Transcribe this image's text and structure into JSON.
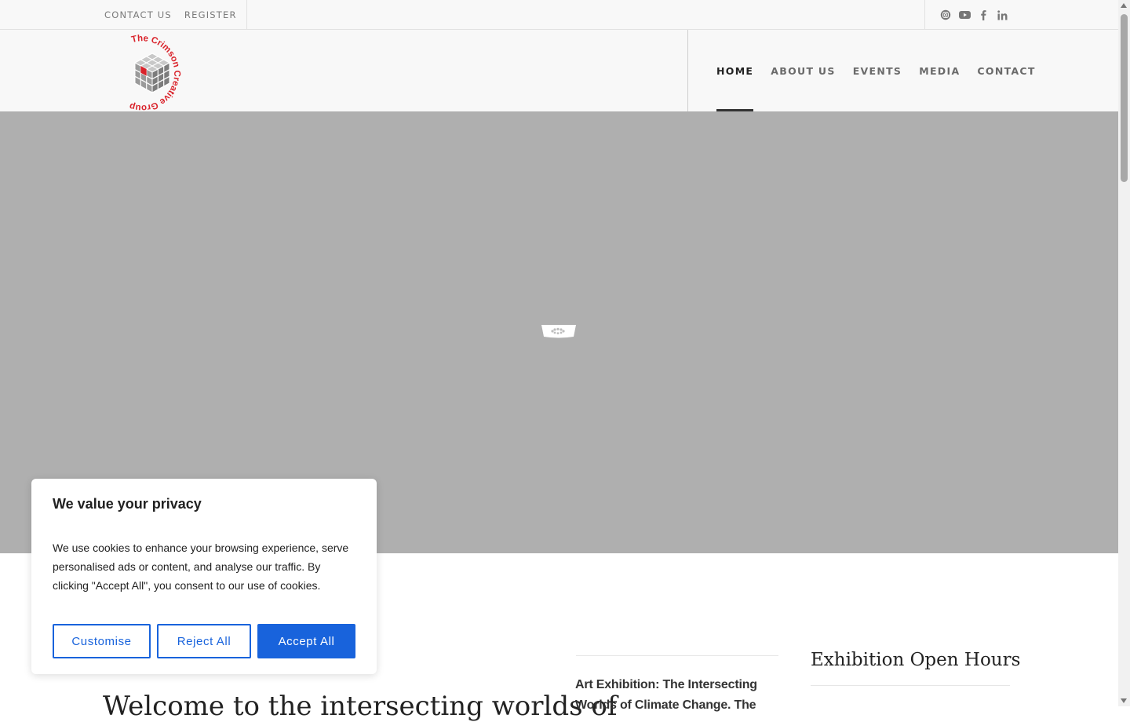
{
  "topbar": {
    "links": [
      "CONTACT US",
      "REGISTER"
    ],
    "social_icons": [
      "instagram-icon",
      "youtube-icon",
      "facebook-icon",
      "linkedin-icon"
    ]
  },
  "brand": {
    "logo_text": "The Crimson Creative Group",
    "accent_color": "#d9222a"
  },
  "nav": {
    "items": [
      "HOME",
      "ABOUT US",
      "EVENTS",
      "MEDIA",
      "CONTACT"
    ],
    "active": "HOME"
  },
  "hero": {
    "background": "#afafaf",
    "loader_icon": "loading-spinner-icon"
  },
  "content": {
    "welcome_heading": "Welcome to the intersecting worlds of",
    "post_title": "Art Exhibition: The Intersecting Worlds of Climate Change. The",
    "hours_title": "Exhibition Open Hours"
  },
  "cookie": {
    "title": "We value your privacy",
    "body": "We use cookies to enhance your browsing experience, serve personalised ads or content, and analyse our traffic. By clicking \"Accept All\", you consent to our use of cookies.",
    "customise": "Customise",
    "reject": "Reject All",
    "accept": "Accept All",
    "button_color": "#1863dc"
  }
}
